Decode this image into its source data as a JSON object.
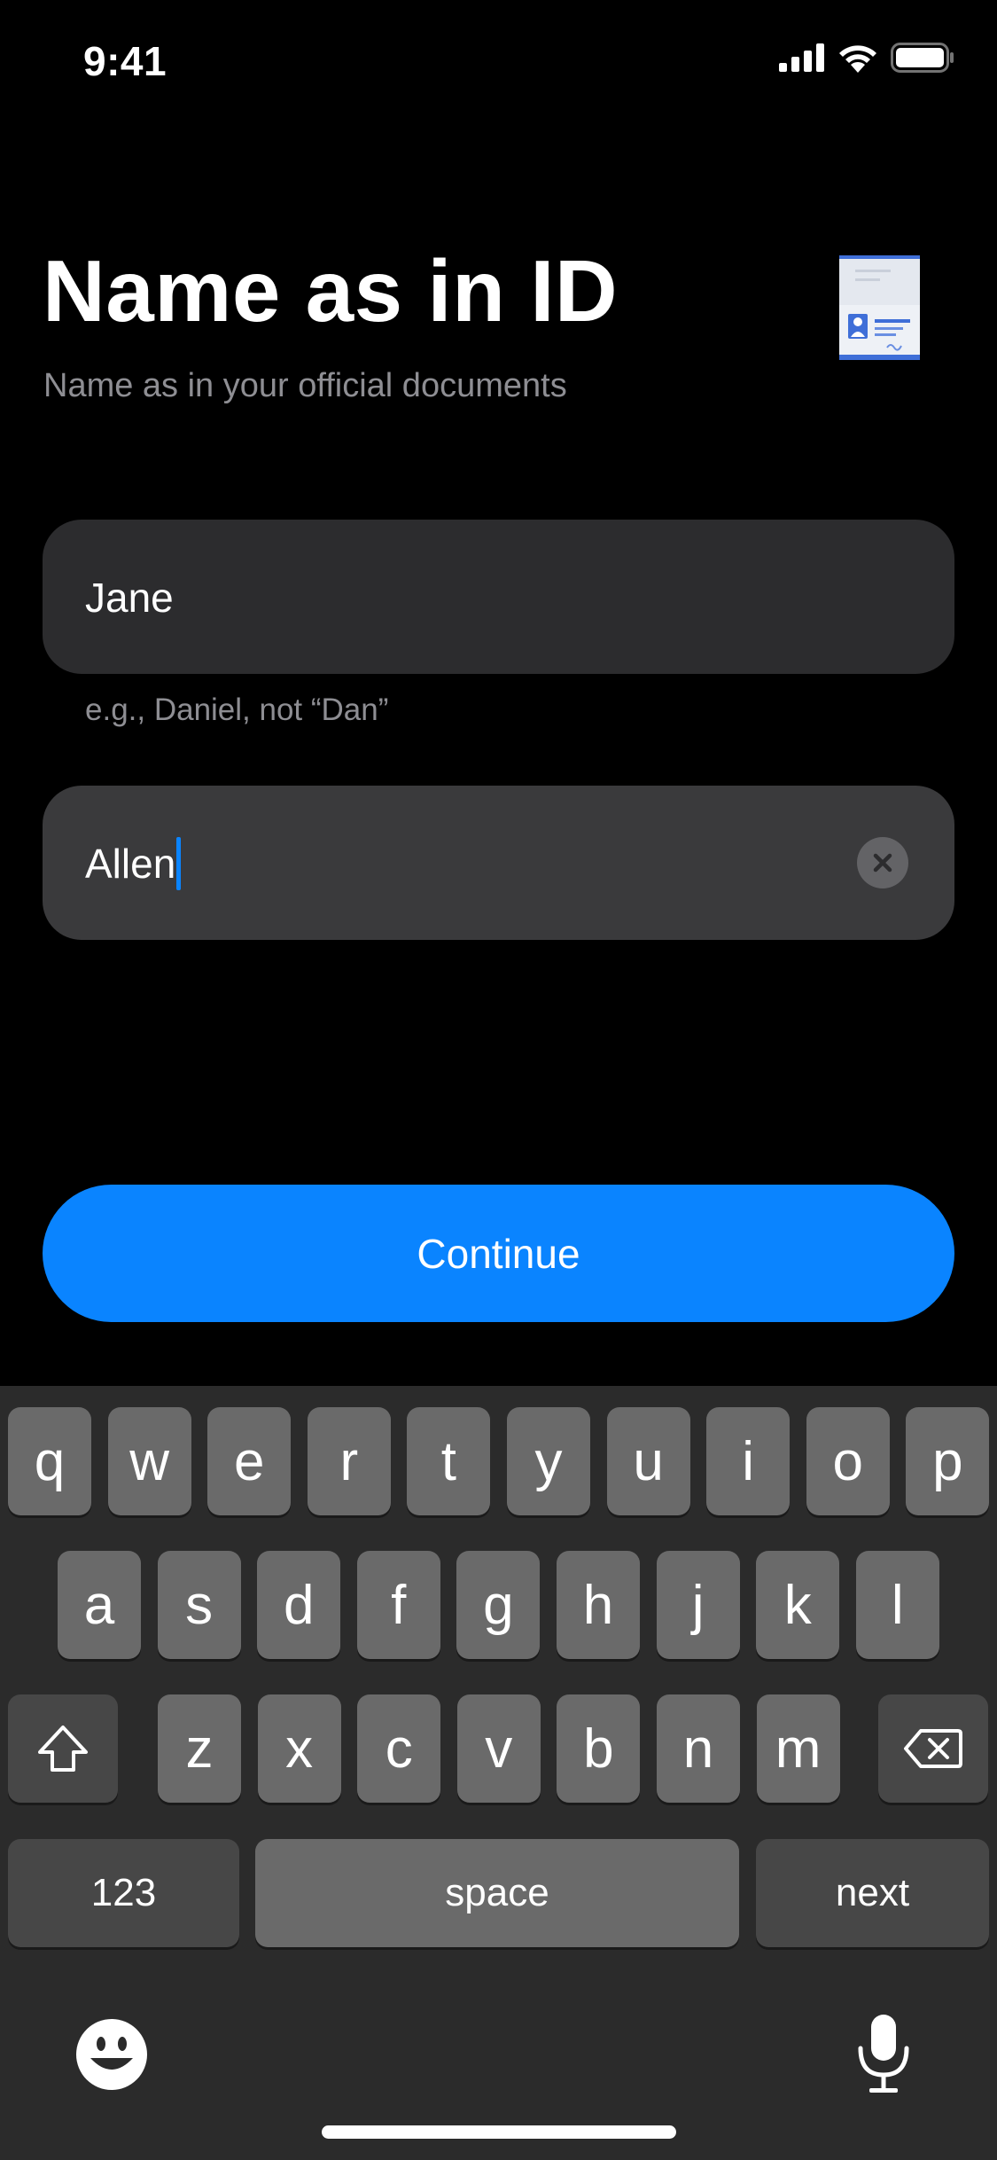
{
  "status_bar": {
    "time": "9:41"
  },
  "header": {
    "title": "Name as in ID",
    "subtitle": "Name as in your official documents"
  },
  "form": {
    "first_name": {
      "value": "Jane",
      "hint": "e.g., Daniel, not “Dan”"
    },
    "last_name": {
      "value": "Allen"
    },
    "continue_label": "Continue"
  },
  "keyboard": {
    "row1": [
      "q",
      "w",
      "e",
      "r",
      "t",
      "y",
      "u",
      "i",
      "o",
      "p"
    ],
    "row2": [
      "a",
      "s",
      "d",
      "f",
      "g",
      "h",
      "j",
      "k",
      "l"
    ],
    "row3": [
      "z",
      "x",
      "c",
      "v",
      "b",
      "n",
      "m"
    ],
    "numbers_label": "123",
    "space_label": "space",
    "return_label": "next"
  },
  "colors": {
    "accent": "#0a84ff",
    "background": "#000000",
    "field": "#2c2c2e",
    "field_active": "#3a3a3c",
    "keyboard": "#2b2b2b",
    "key": "#6a6a6a",
    "key_dark": "#474747",
    "secondary_text": "#8e8e93"
  },
  "icons": [
    "signal-icon",
    "wifi-icon",
    "battery-icon",
    "id-card-icon",
    "clear-icon",
    "shift-icon",
    "backspace-icon",
    "emoji-icon",
    "microphone-icon"
  ]
}
